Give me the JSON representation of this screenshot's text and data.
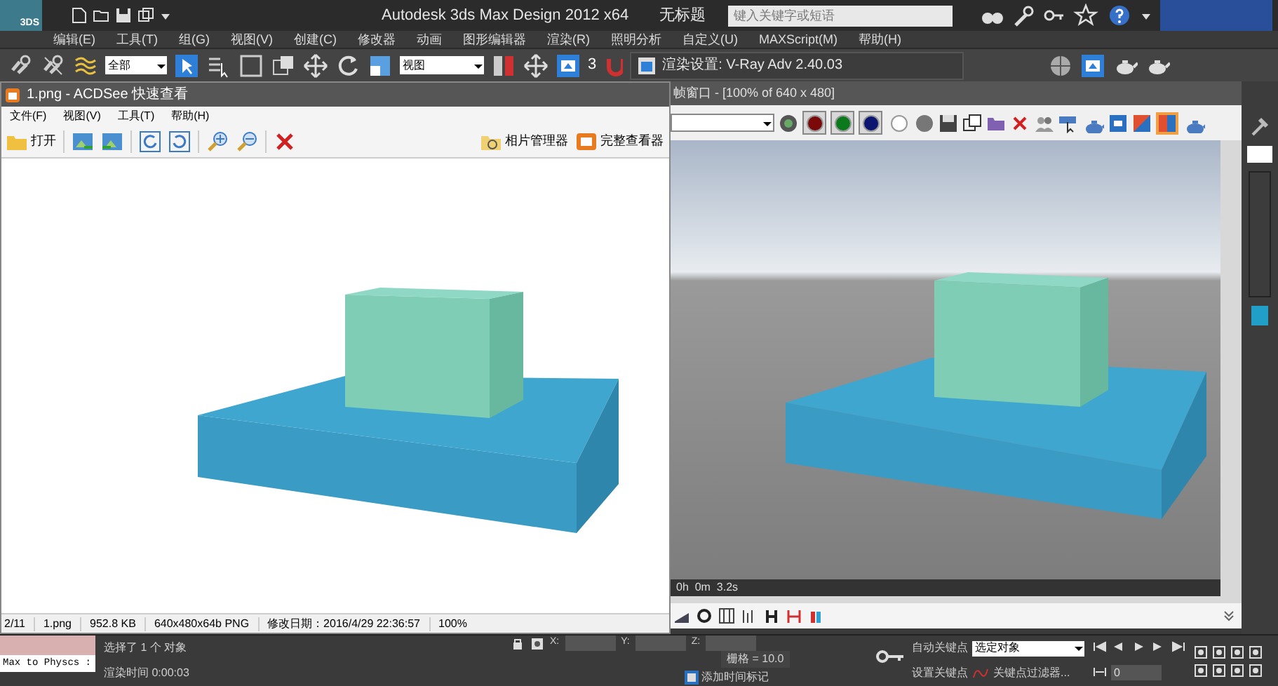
{
  "app": {
    "logo": "3DS",
    "title": "Autodesk 3ds Max Design 2012 x64",
    "document": "无标题",
    "search": {
      "placeholder": "键入关键字或短语"
    }
  },
  "menu": [
    "编辑(E)",
    "工具(T)",
    "组(G)",
    "视图(V)",
    "创建(C)",
    "修改器",
    "动画",
    "图形编辑器",
    "渲染(R)",
    "照明分析",
    "自定义(U)",
    "MAXScript(M)",
    "帮助(H)"
  ],
  "toolbar": {
    "selection_filter": "全部",
    "reference_coord": "视图",
    "snap_label": "3"
  },
  "render_setup_tab": {
    "title": "渲染设置: V-Ray Adv 2.40.03"
  },
  "acdsee": {
    "title": "1.png - ACDSee 快速查看",
    "menu": [
      "文件(F)",
      "视图(V)",
      "工具(T)",
      "帮助(H)"
    ],
    "open": "打开",
    "photo_manager": "相片管理器",
    "full_viewer": "完整查看器",
    "status": [
      "2/11",
      "1.png",
      "952.8 KB",
      "640x480x64b PNG",
      "修改日期：2016/4/29 22:36:57",
      "100%"
    ]
  },
  "frame_buffer": {
    "title": "帧窗口 - [100% of 640 x 480]",
    "channels": [
      {
        "color": "#7a0a0a",
        "selected": true
      },
      {
        "color": "#0b7a1c",
        "selected": true
      },
      {
        "color": "#0a1670",
        "selected": true
      },
      {
        "color": "#ffffff",
        "selected": false
      }
    ],
    "render_time": "0h  0m  3.2s"
  },
  "status": {
    "script_field": "Max to Physcs :",
    "selection": "选择了 1 个 对象",
    "render_time": "渲染时间 0:00:03",
    "coords": [
      "X:",
      "Y:",
      "Z:"
    ],
    "grid": "栅格 = 10.0",
    "add_time_tag": "添加时间标记",
    "auto_key": "自动关键点",
    "key_mode": "选定对象",
    "set_key": "设置关键点",
    "key_filters": "关键点过滤器...",
    "frame": "0"
  }
}
